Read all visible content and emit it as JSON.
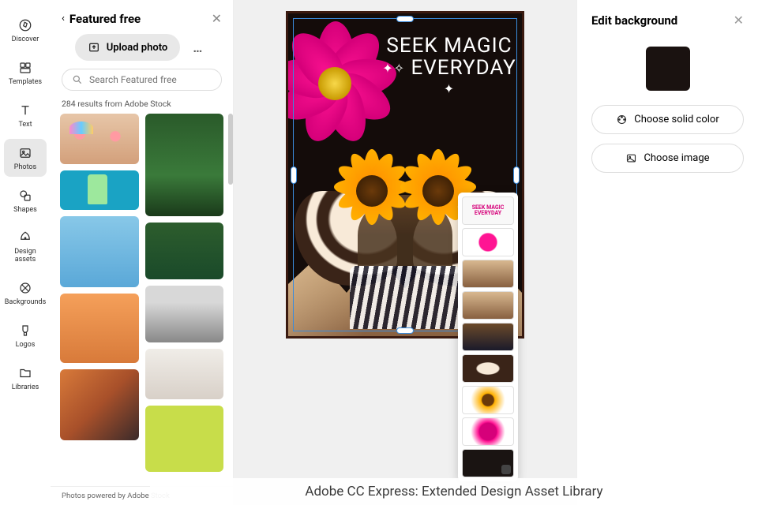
{
  "rail": {
    "items": [
      {
        "label": "Discover"
      },
      {
        "label": "Templates"
      },
      {
        "label": "Text"
      },
      {
        "label": "Photos"
      },
      {
        "label": "Shapes"
      },
      {
        "label": "Design assets"
      },
      {
        "label": "Backgrounds"
      },
      {
        "label": "Logos"
      },
      {
        "label": "Libraries"
      }
    ],
    "active_index": 3
  },
  "panel": {
    "title": "Featured free",
    "upload_label": "Upload photo",
    "search_placeholder": "Search Featured free",
    "results_label": "284 results from Adobe Stock",
    "footer_label": "Photos powered by Adobe Stock"
  },
  "artboard": {
    "headline_line1": "SEEK MAGIC",
    "headline_line2": "EVERYDAY"
  },
  "layers_preview": {
    "text_line1": "SEEK MAGIC",
    "text_line2": "EVERYDAY"
  },
  "prop": {
    "title": "Edit background",
    "swatch_color": "#1a1210",
    "choose_solid_label": "Choose solid color",
    "choose_image_label": "Choose image"
  },
  "caption": "Adobe CC Express: Extended Design Asset Library"
}
